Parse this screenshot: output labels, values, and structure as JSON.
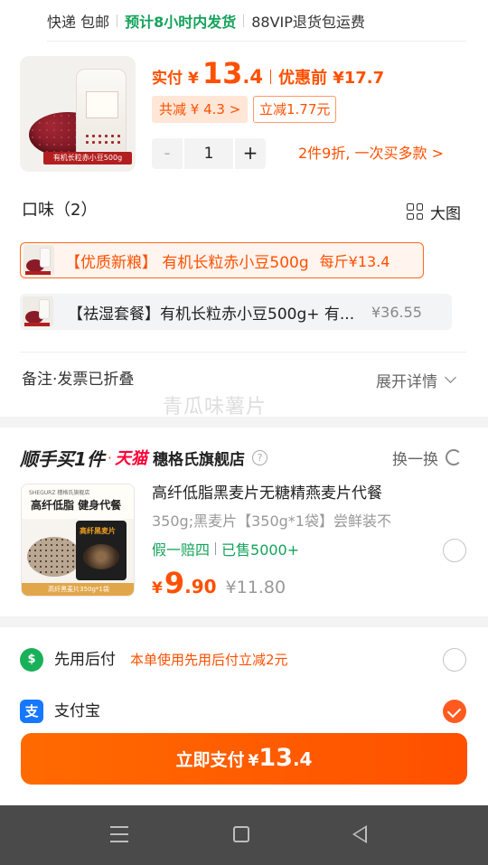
{
  "shipping": {
    "express": "快递 包邮",
    "eta": "预计8小时内发货",
    "vip": "88VIP退货包运费"
  },
  "product": {
    "image_caption": "有机长粒赤小豆500g",
    "price_label": "实付",
    "currency": "¥",
    "price_int": "13",
    "price_dec": ".4",
    "before_discount": "优惠前 ¥17.7",
    "saving_total": "共减 ¥ 4.3 >",
    "saving_instant": "立减1.77元",
    "quantity": "1",
    "minus": "-",
    "plus": "+",
    "bulk_promo": "2件9折, 一次买多款 >"
  },
  "flavor": {
    "title": "口味（2）",
    "big_image": "大图",
    "options": [
      {
        "label": "【优质新粮】 有机长粒赤小豆500g",
        "price": "每斤¥13.4",
        "selected": true
      },
      {
        "label": "【祛湿套餐】有机长粒赤小豆500g+ 有...",
        "price": "¥36.55",
        "selected": false
      }
    ]
  },
  "memo": {
    "label": "备注·发票已折叠",
    "expand": "展开详情"
  },
  "watermark": "青瓜味薯片",
  "recommend": {
    "heading": "顺手买1件",
    "dot": "·",
    "tmall": "天猫",
    "shop": "穗格氏旗舰店",
    "help": "?",
    "swap": "换一换",
    "image_brand": "SHEGURZ 穗格氏旗舰店",
    "image_slogan": "高纤低脂 健身代餐",
    "image_bag_text": "高纤黑麦片",
    "image_footer": "高纤黑麦片350g*1袋",
    "title": "高纤低脂黑麦片无糖精燕麦片代餐",
    "subtitle": "350g;黑麦片【350g*1袋】尝鲜装不",
    "tag1": "假一赔四",
    "tag2": "已售5000+",
    "currency": "¥",
    "price_int": "9",
    "price_dec": ".90",
    "original_price": "¥11.80"
  },
  "payment": {
    "paylater_icon": "$",
    "paylater_name": "先用后付",
    "paylater_note": "本单使用先用后付立减2元",
    "alipay_icon": "支",
    "alipay_name": "支付宝",
    "alipay_selected": true
  },
  "pay_button": {
    "label": "立即支付",
    "currency": "¥",
    "amount_int": "13",
    "amount_dec": ".4"
  },
  "colors": {
    "accent": "#ff5000",
    "green": "#14a35b",
    "alipay": "#1677ff",
    "tmall": "#ff0036"
  }
}
